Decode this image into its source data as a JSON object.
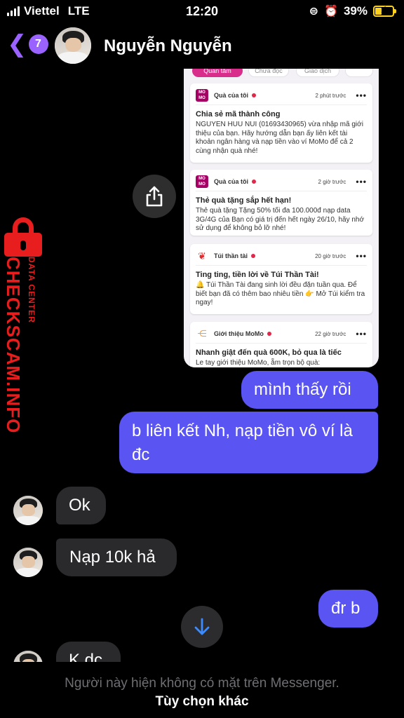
{
  "status_bar": {
    "carrier": "Viettel",
    "network": "LTE",
    "time": "12:20",
    "battery_percent": "39%",
    "battery_level": 0.39
  },
  "header": {
    "back_badge": "7",
    "contact_name": "Nguyễn Nguyễn"
  },
  "shared_image": {
    "tabs": [
      "Quan tâm",
      "Chưa đọc",
      "Giao dịch"
    ],
    "cards": [
      {
        "category": "Quà của tôi",
        "logo": "MO MO",
        "time": "2 phút trước",
        "more": "•••",
        "title": "Chia sẻ mã thành công",
        "body": "NGUYEN HUU NUI (01693430965) vừa nhập mã giới thiệu của bạn. Hãy hướng dẫn bạn ấy liên kết tài khoản ngân hàng và nạp tiền vào ví MoMo để cả 2 cùng nhận quà nhé!"
      },
      {
        "category": "Quà của tôi",
        "logo": "MO MO",
        "time": "2 giờ trước",
        "more": "•••",
        "title": "Thẻ quà tặng sắp hết hạn!",
        "body": "Thẻ quà tặng Tặng 50% tối đa 100.000đ nạp data 3G/4G của Bạn có giá trị đến hết ngày 26/10, hãy nhớ sử dụng để không bỏ lỡ nhé!"
      },
      {
        "category": "Túi thần tài",
        "logo": "lucky-bag-icon",
        "time": "20 giờ trước",
        "more": "•••",
        "title": "Ting ting, tiền lời về Túi Thần Tài!",
        "body": "🔔 Túi Thần Tài đang sinh lời đều đặn tuần qua. Để biết bạn đã có thêm bao nhiêu tiền 👉 Mở Túi kiểm tra ngay!"
      },
      {
        "category": "Giới thiệu MoMo",
        "logo": "share-icon",
        "time": "22 giờ trước",
        "more": "•••",
        "title": "Nhanh giật đến quà 600K, bỏ qua là tiếc",
        "body": "Le tay giới thiệu MoMo, ẵm trọn bộ quà:"
      }
    ]
  },
  "watermark": {
    "main": "CHECKSCAM.INFO",
    "sub": "DATA CENTER"
  },
  "messages": [
    {
      "direction": "out",
      "text": "mình thấy rồi"
    },
    {
      "direction": "out",
      "text": "b liên kết Nh, nạp tiền vô ví là đc"
    },
    {
      "direction": "in",
      "text": "Ok"
    },
    {
      "direction": "in",
      "text": "Nạp 10k hả"
    },
    {
      "direction": "out",
      "text": "đr b"
    },
    {
      "direction": "in",
      "text": "K dc"
    }
  ],
  "footer": {
    "note": "Người này hiện không có mặt trên Messenger.",
    "link": "Tùy chọn khác"
  },
  "colors": {
    "outgoing_bubble": "#5a54f2",
    "incoming_bubble": "#2a2a2c",
    "accent": "#9a63ff",
    "momo_brand": "#a50064",
    "watermark": "#e81d1d"
  }
}
